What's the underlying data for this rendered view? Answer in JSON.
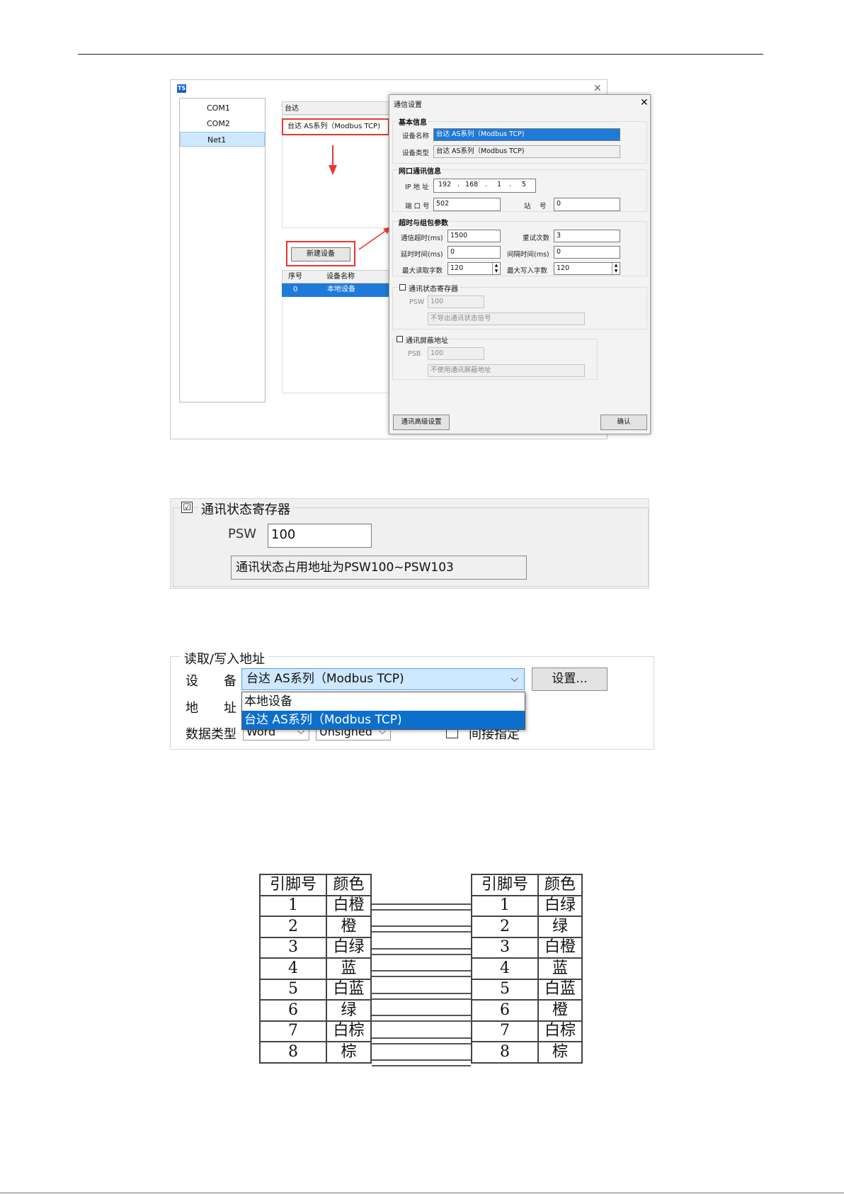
{
  "figure1": {
    "app_logo": "TS",
    "ports": [
      "COM1",
      "COM2",
      "Net1"
    ],
    "selected_port": "Net1",
    "device_list_header": "台达",
    "device_list_item": "台达 AS系列（Modbus TCP)",
    "new_device_button": "新建设备",
    "device_table": {
      "columns": [
        "序号",
        "设备名称"
      ],
      "rows": [
        [
          "0",
          "本地设备"
        ]
      ]
    },
    "dialog": {
      "title": "通信设置",
      "basic_group": "基本信息",
      "device_name_label": "设备名称",
      "device_name_value": "台达 AS系列（Modbus TCP)",
      "device_type_label": "设备类型",
      "device_type_value": "台达 AS系列（Modbus TCP)",
      "net_group": "网口通讯信息",
      "ip_label": "IP 地 址",
      "ip": [
        "192",
        "168",
        "1",
        "5"
      ],
      "port_label": "端 口 号",
      "port_value": "502",
      "station_label": "站　 号",
      "station_value": "0",
      "timeout_group": "超时与组包参数",
      "comm_timeout_label": "通信超时(ms)",
      "comm_timeout_value": "1500",
      "retry_label": "重试次数",
      "retry_value": "3",
      "delay_label": "延时时间(ms)",
      "delay_value": "0",
      "interval_label": "间隔时间(ms)",
      "interval_value": "0",
      "max_read_label": "最大读取字数",
      "max_read_value": "120",
      "max_write_label": "最大写入字数",
      "max_write_value": "120",
      "status_reg_label": "通讯状态寄存器",
      "psw_label": "PSW",
      "psw_value": "100",
      "psw_note": "不导出通讯状态信号",
      "mask_label": "通讯屏蔽地址",
      "psb_label": "PSB",
      "psb_value": "100",
      "psb_note": "不使用通讯屏蔽地址",
      "advanced_button": "通讯高级设置",
      "ok_button": "确认"
    }
  },
  "figure2": {
    "check_mark": "☑",
    "status_reg_label": "通讯状态寄存器",
    "psw_label": "PSW",
    "psw_value": "100",
    "note": "通讯状态占用地址为PSW100~PSW103"
  },
  "figure3": {
    "group_label": "读取/写入地址",
    "device_label": "设　　备",
    "device_value": "台达 AS系列（Modbus TCP)",
    "settings_button": "设置...",
    "address_label": "地　　址",
    "dropdown_options": [
      "本地设备",
      "台达 AS系列（Modbus TCP)"
    ],
    "dtype_label": "数据类型",
    "dtype_value": "Word",
    "sign_value": "Unsigned",
    "indirect_label": "间接指定"
  },
  "pinout": {
    "left": {
      "headers": [
        "引脚号",
        "颜色"
      ],
      "rows": [
        [
          "1",
          "白橙"
        ],
        [
          "2",
          "橙"
        ],
        [
          "3",
          "白绿"
        ],
        [
          "4",
          "蓝"
        ],
        [
          "5",
          "白蓝"
        ],
        [
          "6",
          "绿"
        ],
        [
          "7",
          "白棕"
        ],
        [
          "8",
          "棕"
        ]
      ]
    },
    "right": {
      "headers": [
        "引脚号",
        "颜色"
      ],
      "rows": [
        [
          "1",
          "白绿"
        ],
        [
          "2",
          "绿"
        ],
        [
          "3",
          "白橙"
        ],
        [
          "4",
          "蓝"
        ],
        [
          "5",
          "白蓝"
        ],
        [
          "6",
          "橙"
        ],
        [
          "7",
          "白棕"
        ],
        [
          "8",
          "棕"
        ]
      ]
    }
  }
}
